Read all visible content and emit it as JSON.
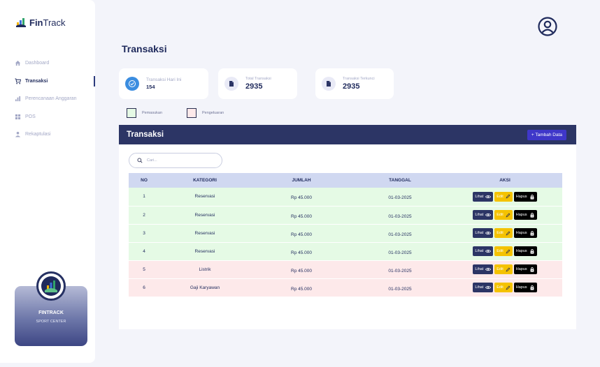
{
  "brand": {
    "name_bold": "Fin",
    "name_rest": "Track"
  },
  "nav": [
    {
      "label": "Dashboard",
      "icon": "home-icon",
      "active": false
    },
    {
      "label": "Transaksi",
      "icon": "cart-icon",
      "active": true
    },
    {
      "label": "Perencanaan Anggaran",
      "icon": "bar-chart-icon",
      "active": false
    },
    {
      "label": "POS",
      "icon": "grid-icon",
      "active": false
    },
    {
      "label": "Rekaptulasi",
      "icon": "user-icon",
      "active": false
    }
  ],
  "promo": {
    "title": "FINTRACK",
    "subtitle": "SPORT CENTER"
  },
  "page_title": "Transaksi",
  "stats": [
    {
      "label": "Transaksi Hari Ini",
      "value": "154",
      "icon": "check-badge-icon"
    },
    {
      "label": "Total Transaksi",
      "value": "2935",
      "icon": "document-icon"
    },
    {
      "label": "Transaksi Terkunci",
      "value": "2935",
      "icon": "document-icon"
    }
  ],
  "legend": [
    {
      "label": "Pemasukan",
      "color": "#e5fae5"
    },
    {
      "label": "Pengeluaran",
      "color": "#fde9ea"
    }
  ],
  "panel": {
    "title": "Transaksi",
    "add_label": "+ Tambah Data",
    "search_placeholder": "Cari..."
  },
  "table": {
    "headers": [
      "NO",
      "KATEGORI",
      "JUMLAH",
      "TANGGAL",
      "AKSI"
    ],
    "rows": [
      {
        "no": "1",
        "kategori": "Reservasi",
        "jumlah": "Rp 45.000",
        "tanggal": "01-03-2025",
        "type": "in"
      },
      {
        "no": "2",
        "kategori": "Reservasi",
        "jumlah": "Rp 45.000",
        "tanggal": "01-03-2025",
        "type": "in"
      },
      {
        "no": "3",
        "kategori": "Reservasi",
        "jumlah": "Rp 45.000",
        "tanggal": "01-03-2025",
        "type": "in"
      },
      {
        "no": "4",
        "kategori": "Reservasi",
        "jumlah": "Rp 45.000",
        "tanggal": "01-03-2025",
        "type": "in"
      },
      {
        "no": "5",
        "kategori": "Listrik",
        "jumlah": "Rp 45.000",
        "tanggal": "01-03-2025",
        "type": "out"
      },
      {
        "no": "6",
        "kategori": "Gaji Karyawan",
        "jumlah": "Rp 45.000",
        "tanggal": "01-03-2025",
        "type": "out"
      }
    ],
    "actions": {
      "view": "Lihat",
      "edit": "Edit",
      "delete": "Hapus"
    }
  }
}
